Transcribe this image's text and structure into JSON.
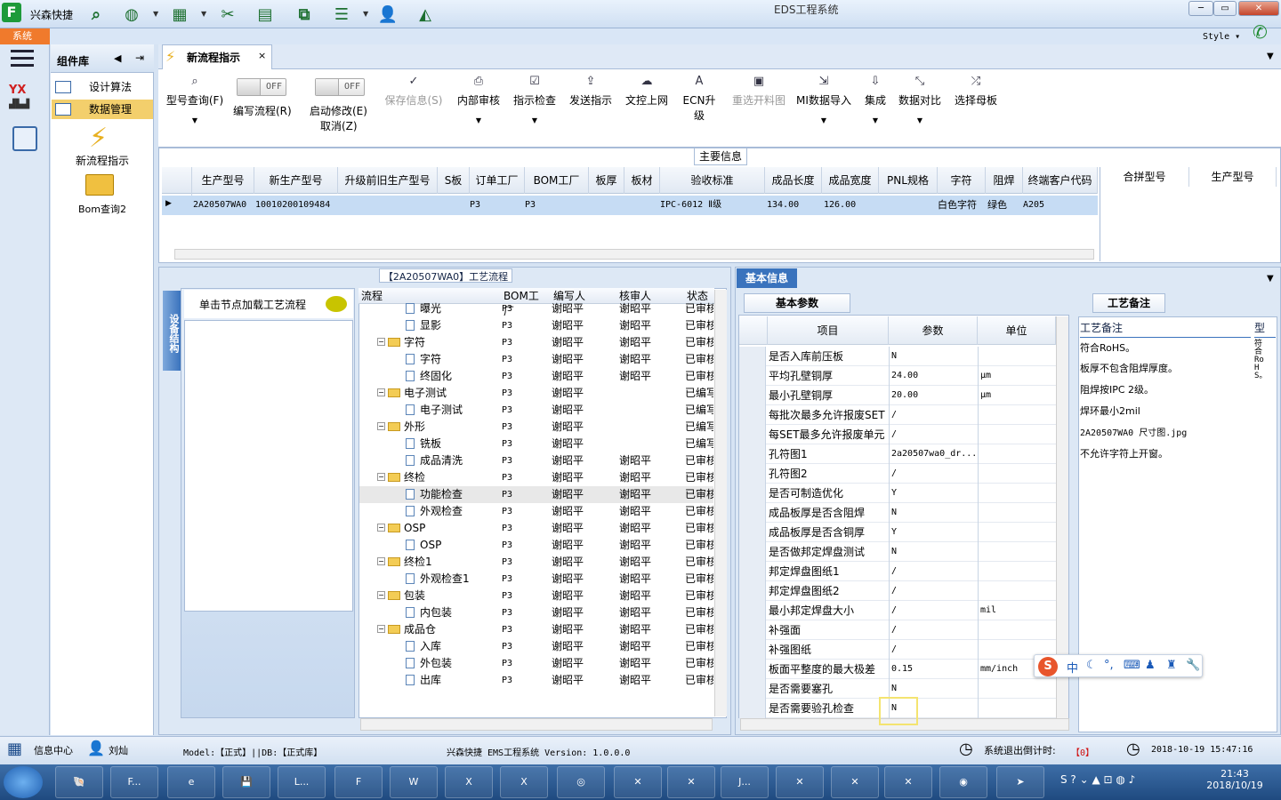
{
  "window": {
    "title": "EDS工程系统",
    "app_name": "兴森快捷",
    "style_label": "Style",
    "min": "─",
    "max": "▭",
    "close": "✕"
  },
  "menu": {
    "system_tab": "系统"
  },
  "component_library": {
    "title": "组件库",
    "items": [
      {
        "label": "设计算法",
        "active": false
      },
      {
        "label": "数据管理",
        "active": true
      }
    ],
    "tools": [
      {
        "label": "新流程指示",
        "icon": "lightning-icon"
      },
      {
        "label": "Bom查询2",
        "icon": "folder-icon"
      }
    ]
  },
  "tabs": [
    {
      "label": "新流程指示",
      "close": "×"
    }
  ],
  "toolbar": {
    "buttons": [
      {
        "label": "型号查询(F)",
        "icon": "search-icon",
        "disabled": false
      },
      {
        "label": "保存信息(S)",
        "icon": "check-icon",
        "disabled": true
      },
      {
        "label": "内部审核",
        "icon": "print-icon",
        "disabled": false
      },
      {
        "label": "指示检查",
        "icon": "checkbox-icon",
        "disabled": false
      },
      {
        "label": "发送指示",
        "icon": "upload-icon",
        "disabled": false
      },
      {
        "label": "文控上网",
        "icon": "cloud-upload-icon",
        "disabled": false
      },
      {
        "label": "ECN升级",
        "icon": "ecn-icon",
        "disabled": false
      },
      {
        "label": "重选开料图",
        "icon": "image-icon",
        "disabled": true
      },
      {
        "label": "MI数据导入",
        "icon": "import-icon",
        "disabled": false
      },
      {
        "label": "集成",
        "icon": "download-icon",
        "disabled": false
      },
      {
        "label": "数据对比",
        "icon": "compare-icon",
        "disabled": false
      },
      {
        "label": "选择母板",
        "icon": "shuffle-icon",
        "disabled": false
      }
    ],
    "toggles": [
      {
        "state": "OFF",
        "label": "编写流程(R)"
      },
      {
        "state": "OFF",
        "label": "启动修改(E)",
        "sub": "取消(Z)"
      }
    ]
  },
  "main_info": {
    "title": "主要信息",
    "columns": [
      "生产型号",
      "新生产型号",
      "升级前旧生产型号",
      "S板",
      "订单工厂",
      "BOM工厂",
      "板厚",
      "板材",
      "验收标准",
      "成品长度",
      "成品宽度",
      "PNL规格",
      "字符",
      "阻焊",
      "终端客户代码"
    ],
    "row": [
      "2A20507WA0",
      "10010200109484",
      "",
      "",
      "P3",
      "P3",
      "",
      "",
      "IPC-6012 Ⅱ级",
      "134.00",
      "126.00",
      "",
      "白色字符",
      "绿色",
      "A205"
    ],
    "right_columns": [
      "合拼型号",
      "生产型号"
    ]
  },
  "process_flow": {
    "title": "【2A20507WA0】工艺流程",
    "side_tab": "设备结构",
    "node_hint": "单击节点加载工艺流程",
    "columns": [
      "流程",
      "BOM工厂",
      "编写人",
      "核审人",
      "状态"
    ],
    "rows": [
      {
        "name": "曝光",
        "level": 2,
        "folder": false,
        "factory": "P3",
        "writer": "谢昭平",
        "reviewer": "谢昭平",
        "status": "已审核"
      },
      {
        "name": "显影",
        "level": 2,
        "folder": false,
        "factory": "P3",
        "writer": "谢昭平",
        "reviewer": "谢昭平",
        "status": "已审核"
      },
      {
        "name": "字符",
        "level": 1,
        "folder": true,
        "factory": "P3",
        "writer": "谢昭平",
        "reviewer": "谢昭平",
        "status": "已审核"
      },
      {
        "name": "字符",
        "level": 2,
        "folder": false,
        "factory": "P3",
        "writer": "谢昭平",
        "reviewer": "谢昭平",
        "status": "已审核"
      },
      {
        "name": "终固化",
        "level": 2,
        "folder": false,
        "factory": "P3",
        "writer": "谢昭平",
        "reviewer": "谢昭平",
        "status": "已审核"
      },
      {
        "name": "电子测试",
        "level": 1,
        "folder": true,
        "factory": "P3",
        "writer": "谢昭平",
        "reviewer": "",
        "status": "已编写"
      },
      {
        "name": "电子测试",
        "level": 2,
        "folder": false,
        "factory": "P3",
        "writer": "谢昭平",
        "reviewer": "",
        "status": "已编写"
      },
      {
        "name": "外形",
        "level": 1,
        "folder": true,
        "factory": "P3",
        "writer": "谢昭平",
        "reviewer": "",
        "status": "已编写"
      },
      {
        "name": "铣板",
        "level": 2,
        "folder": false,
        "factory": "P3",
        "writer": "谢昭平",
        "reviewer": "",
        "status": "已编写"
      },
      {
        "name": "成品清洗",
        "level": 2,
        "folder": false,
        "factory": "P3",
        "writer": "谢昭平",
        "reviewer": "谢昭平",
        "status": "已审核"
      },
      {
        "name": "终检",
        "level": 1,
        "folder": true,
        "factory": "P3",
        "writer": "谢昭平",
        "reviewer": "谢昭平",
        "status": "已审核"
      },
      {
        "name": "功能检查",
        "level": 2,
        "folder": false,
        "factory": "P3",
        "writer": "谢昭平",
        "reviewer": "谢昭平",
        "status": "已审核"
      },
      {
        "name": "外观检查",
        "level": 2,
        "folder": false,
        "factory": "P3",
        "writer": "谢昭平",
        "reviewer": "谢昭平",
        "status": "已审核"
      },
      {
        "name": "OSP",
        "level": 1,
        "folder": true,
        "factory": "P3",
        "writer": "谢昭平",
        "reviewer": "谢昭平",
        "status": "已审核"
      },
      {
        "name": "OSP",
        "level": 2,
        "folder": false,
        "factory": "P3",
        "writer": "谢昭平",
        "reviewer": "谢昭平",
        "status": "已审核"
      },
      {
        "name": "终检1",
        "level": 1,
        "folder": true,
        "factory": "P3",
        "writer": "谢昭平",
        "reviewer": "谢昭平",
        "status": "已审核"
      },
      {
        "name": "外观检查1",
        "level": 2,
        "folder": false,
        "factory": "P3",
        "writer": "谢昭平",
        "reviewer": "谢昭平",
        "status": "已审核"
      },
      {
        "name": "包装",
        "level": 1,
        "folder": true,
        "factory": "P3",
        "writer": "谢昭平",
        "reviewer": "谢昭平",
        "status": "已审核"
      },
      {
        "name": "内包装",
        "level": 2,
        "folder": false,
        "factory": "P3",
        "writer": "谢昭平",
        "reviewer": "谢昭平",
        "status": "已审核"
      },
      {
        "name": "成品仓",
        "level": 1,
        "folder": true,
        "factory": "P3",
        "writer": "谢昭平",
        "reviewer": "谢昭平",
        "status": "已审核"
      },
      {
        "name": "入库",
        "level": 2,
        "folder": false,
        "factory": "P3",
        "writer": "谢昭平",
        "reviewer": "谢昭平",
        "status": "已审核"
      },
      {
        "name": "外包装",
        "level": 2,
        "folder": false,
        "factory": "P3",
        "writer": "谢昭平",
        "reviewer": "谢昭平",
        "status": "已审核"
      },
      {
        "name": "出库",
        "level": 2,
        "folder": false,
        "factory": "P3",
        "writer": "谢昭平",
        "reviewer": "谢昭平",
        "status": "已审核"
      }
    ]
  },
  "basic_info": {
    "title": "基本信息",
    "tab": "基本参数",
    "columns": [
      "项目",
      "参数",
      "单位"
    ],
    "rows": [
      {
        "item": "是否入库前压板",
        "value": "N",
        "unit": ""
      },
      {
        "item": "平均孔壁铜厚",
        "value": "24.00",
        "unit": "μm"
      },
      {
        "item": "最小孔壁铜厚",
        "value": "20.00",
        "unit": "μm"
      },
      {
        "item": "每批次最多允许报废SET",
        "value": "/",
        "unit": ""
      },
      {
        "item": "每SET最多允许报废单元",
        "value": "/",
        "unit": ""
      },
      {
        "item": "孔符图1",
        "value": "2a20507wa0_dr...",
        "unit": ""
      },
      {
        "item": "孔符图2",
        "value": "/",
        "unit": ""
      },
      {
        "item": "是否可制造优化",
        "value": "Y",
        "unit": ""
      },
      {
        "item": "成品板厚是否含阻焊",
        "value": "N",
        "unit": ""
      },
      {
        "item": "成品板厚是否含铜厚",
        "value": "Y",
        "unit": ""
      },
      {
        "item": "是否做邦定焊盘测试",
        "value": "N",
        "unit": ""
      },
      {
        "item": "邦定焊盘图纸1",
        "value": "/",
        "unit": ""
      },
      {
        "item": "邦定焊盘图纸2",
        "value": "/",
        "unit": ""
      },
      {
        "item": "最小邦定焊盘大小",
        "value": "/",
        "unit": "mil"
      },
      {
        "item": "补强面",
        "value": "/",
        "unit": ""
      },
      {
        "item": "补强图纸",
        "value": "/",
        "unit": ""
      },
      {
        "item": "板面平整度的最大极差",
        "value": "0.15",
        "unit": "mm/inch"
      },
      {
        "item": "是否需要塞孔",
        "value": "N",
        "unit": ""
      },
      {
        "item": "是否需要验孔检查",
        "value": "N",
        "unit": ""
      }
    ]
  },
  "process_notes": {
    "tab": "工艺备注",
    "column": "工艺备注",
    "column2": "型",
    "notes": [
      "符合RoHS。",
      "板厚不包含阻焊厚度。",
      "阻焊按IPC 2级。",
      "焊环最小2mil",
      "2A20507WA0  尺寸图.jpg",
      "不允许字符上开窗。"
    ],
    "vertical_text": "符合RoHS。"
  },
  "ime": {
    "s_logo": "S",
    "mode": "中"
  },
  "status": {
    "info_center": "信息中心",
    "user": "刘灿",
    "model": "Model:【正式】||DB:【正式库】",
    "version": "兴森快捷  EMS工程系统  Version: 1.0.0.0",
    "countdown_label": "系统退出倒计时:",
    "countdown_value": "【0】",
    "datetime": "2018-10-19 15:47:16"
  },
  "taskbar": {
    "tasks": [
      "F...",
      "L...",
      "J..."
    ],
    "time": "21:43",
    "date": "2018/10/19"
  }
}
